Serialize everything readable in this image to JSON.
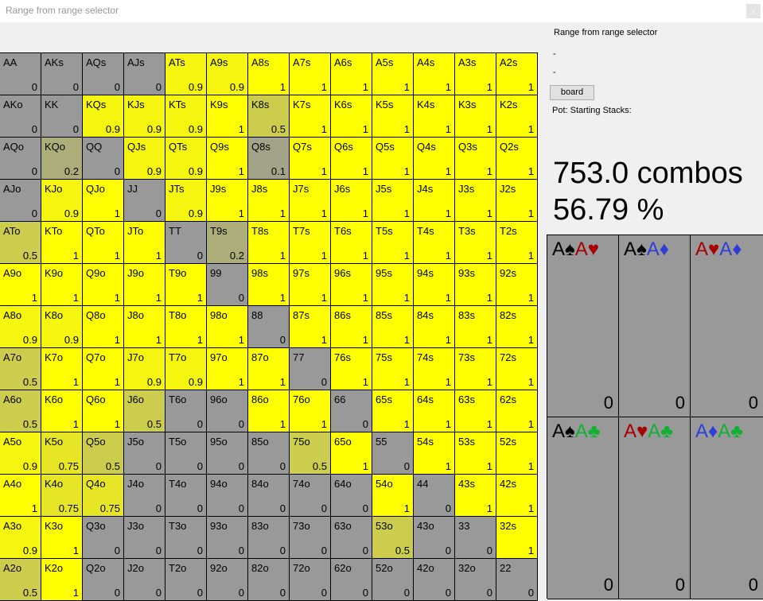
{
  "window": {
    "title": "Range from range selector",
    "close_label": "x"
  },
  "colors": {
    "excluded": "#999999",
    "included": "#FFFF00",
    "spade": "#000000",
    "heart": "#a80000",
    "diamond": "#2f3fd6",
    "club": "#10b030"
  },
  "range_grid": {
    "rows": [
      [
        [
          "AA",
          0
        ],
        [
          "AKs",
          0
        ],
        [
          "AQs",
          0
        ],
        [
          "AJs",
          0
        ],
        [
          "ATs",
          0.9
        ],
        [
          "A9s",
          0.9
        ],
        [
          "A8s",
          1
        ],
        [
          "A7s",
          1
        ],
        [
          "A6s",
          1
        ],
        [
          "A5s",
          1
        ],
        [
          "A4s",
          1
        ],
        [
          "A3s",
          1
        ],
        [
          "A2s",
          1
        ]
      ],
      [
        [
          "AKo",
          0
        ],
        [
          "KK",
          0
        ],
        [
          "KQs",
          0.9
        ],
        [
          "KJs",
          0.9
        ],
        [
          "KTs",
          0.9
        ],
        [
          "K9s",
          1
        ],
        [
          "K8s",
          0.5
        ],
        [
          "K7s",
          1
        ],
        [
          "K6s",
          1
        ],
        [
          "K5s",
          1
        ],
        [
          "K4s",
          1
        ],
        [
          "K3s",
          1
        ],
        [
          "K2s",
          1
        ]
      ],
      [
        [
          "AQo",
          0
        ],
        [
          "KQo",
          0.2
        ],
        [
          "QQ",
          0
        ],
        [
          "QJs",
          0.9
        ],
        [
          "QTs",
          0.9
        ],
        [
          "Q9s",
          1
        ],
        [
          "Q8s",
          0.1
        ],
        [
          "Q7s",
          1
        ],
        [
          "Q6s",
          1
        ],
        [
          "Q5s",
          1
        ],
        [
          "Q4s",
          1
        ],
        [
          "Q3s",
          1
        ],
        [
          "Q2s",
          1
        ]
      ],
      [
        [
          "AJo",
          0
        ],
        [
          "KJo",
          0.9
        ],
        [
          "QJo",
          1
        ],
        [
          "JJ",
          0
        ],
        [
          "JTs",
          0.9
        ],
        [
          "J9s",
          1
        ],
        [
          "J8s",
          1
        ],
        [
          "J7s",
          1
        ],
        [
          "J6s",
          1
        ],
        [
          "J5s",
          1
        ],
        [
          "J4s",
          1
        ],
        [
          "J3s",
          1
        ],
        [
          "J2s",
          1
        ]
      ],
      [
        [
          "ATo",
          0.5
        ],
        [
          "KTo",
          1
        ],
        [
          "QTo",
          1
        ],
        [
          "JTo",
          1
        ],
        [
          "TT",
          0
        ],
        [
          "T9s",
          0.2
        ],
        [
          "T8s",
          1
        ],
        [
          "T7s",
          1
        ],
        [
          "T6s",
          1
        ],
        [
          "T5s",
          1
        ],
        [
          "T4s",
          1
        ],
        [
          "T3s",
          1
        ],
        [
          "T2s",
          1
        ]
      ],
      [
        [
          "A9o",
          1
        ],
        [
          "K9o",
          1
        ],
        [
          "Q9o",
          1
        ],
        [
          "J9o",
          1
        ],
        [
          "T9o",
          1
        ],
        [
          "99",
          0
        ],
        [
          "98s",
          1
        ],
        [
          "97s",
          1
        ],
        [
          "96s",
          1
        ],
        [
          "95s",
          1
        ],
        [
          "94s",
          1
        ],
        [
          "93s",
          1
        ],
        [
          "92s",
          1
        ]
      ],
      [
        [
          "A8o",
          0.9
        ],
        [
          "K8o",
          0.9
        ],
        [
          "Q8o",
          1
        ],
        [
          "J8o",
          1
        ],
        [
          "T8o",
          1
        ],
        [
          "98o",
          1
        ],
        [
          "88",
          0
        ],
        [
          "87s",
          1
        ],
        [
          "86s",
          1
        ],
        [
          "85s",
          1
        ],
        [
          "84s",
          1
        ],
        [
          "83s",
          1
        ],
        [
          "82s",
          1
        ]
      ],
      [
        [
          "A7o",
          0.5
        ],
        [
          "K7o",
          1
        ],
        [
          "Q7o",
          1
        ],
        [
          "J7o",
          0.9
        ],
        [
          "T7o",
          0.9
        ],
        [
          "97o",
          1
        ],
        [
          "87o",
          1
        ],
        [
          "77",
          0
        ],
        [
          "76s",
          1
        ],
        [
          "75s",
          1
        ],
        [
          "74s",
          1
        ],
        [
          "73s",
          1
        ],
        [
          "72s",
          1
        ]
      ],
      [
        [
          "A6o",
          0.5
        ],
        [
          "K6o",
          1
        ],
        [
          "Q6o",
          1
        ],
        [
          "J6o",
          0.5
        ],
        [
          "T6o",
          0
        ],
        [
          "96o",
          0
        ],
        [
          "86o",
          1
        ],
        [
          "76o",
          1
        ],
        [
          "66",
          0
        ],
        [
          "65s",
          1
        ],
        [
          "64s",
          1
        ],
        [
          "63s",
          1
        ],
        [
          "62s",
          1
        ]
      ],
      [
        [
          "A5o",
          0.9
        ],
        [
          "K5o",
          0.75
        ],
        [
          "Q5o",
          0.5
        ],
        [
          "J5o",
          0
        ],
        [
          "T5o",
          0
        ],
        [
          "95o",
          0
        ],
        [
          "85o",
          0
        ],
        [
          "75o",
          0.5
        ],
        [
          "65o",
          1
        ],
        [
          "55",
          0
        ],
        [
          "54s",
          1
        ],
        [
          "53s",
          1
        ],
        [
          "52s",
          1
        ]
      ],
      [
        [
          "A4o",
          1
        ],
        [
          "K4o",
          0.75
        ],
        [
          "Q4o",
          0.75
        ],
        [
          "J4o",
          0
        ],
        [
          "T4o",
          0
        ],
        [
          "94o",
          0
        ],
        [
          "84o",
          0
        ],
        [
          "74o",
          0
        ],
        [
          "64o",
          0
        ],
        [
          "54o",
          1
        ],
        [
          "44",
          0
        ],
        [
          "43s",
          1
        ],
        [
          "42s",
          1
        ]
      ],
      [
        [
          "A3o",
          0.9
        ],
        [
          "K3o",
          1
        ],
        [
          "Q3o",
          0
        ],
        [
          "J3o",
          0
        ],
        [
          "T3o",
          0
        ],
        [
          "93o",
          0
        ],
        [
          "83o",
          0
        ],
        [
          "73o",
          0
        ],
        [
          "63o",
          0
        ],
        [
          "53o",
          0.5
        ],
        [
          "43o",
          0
        ],
        [
          "33",
          0
        ],
        [
          "32s",
          1
        ]
      ],
      [
        [
          "A2o",
          0.5
        ],
        [
          "K2o",
          1
        ],
        [
          "Q2o",
          0
        ],
        [
          "J2o",
          0
        ],
        [
          "T2o",
          0
        ],
        [
          "92o",
          0
        ],
        [
          "82o",
          0
        ],
        [
          "72o",
          0
        ],
        [
          "62o",
          0
        ],
        [
          "52o",
          0
        ],
        [
          "42o",
          0
        ],
        [
          "32o",
          0
        ],
        [
          "22",
          0
        ]
      ]
    ]
  },
  "side_panel": {
    "range_label": "Range from range selector",
    "line1": "-",
    "line2": "-",
    "board_button": "board",
    "pot_label": "Pot:  Starting Stacks:",
    "combos_text": "753.0 combos",
    "percent_text": "56.79 %"
  },
  "combo_breakdown": [
    {
      "cards": [
        {
          "rank": "A",
          "suit": "♠",
          "color": "spade"
        },
        {
          "rank": "A",
          "suit": "♥",
          "color": "heart"
        }
      ],
      "count": "0"
    },
    {
      "cards": [
        {
          "rank": "A",
          "suit": "♠",
          "color": "spade"
        },
        {
          "rank": "A",
          "suit": "♦",
          "color": "diamond"
        }
      ],
      "count": "0"
    },
    {
      "cards": [
        {
          "rank": "A",
          "suit": "♥",
          "color": "heart"
        },
        {
          "rank": "A",
          "suit": "♦",
          "color": "diamond"
        }
      ],
      "count": "0"
    },
    {
      "cards": [
        {
          "rank": "A",
          "suit": "♠",
          "color": "spade"
        },
        {
          "rank": "A",
          "suit": "♣",
          "color": "club"
        }
      ],
      "count": "0"
    },
    {
      "cards": [
        {
          "rank": "A",
          "suit": "♥",
          "color": "heart"
        },
        {
          "rank": "A",
          "suit": "♣",
          "color": "club"
        }
      ],
      "count": "0"
    },
    {
      "cards": [
        {
          "rank": "A",
          "suit": "♦",
          "color": "diamond"
        },
        {
          "rank": "A",
          "suit": "♣",
          "color": "club"
        }
      ],
      "count": "0"
    }
  ]
}
